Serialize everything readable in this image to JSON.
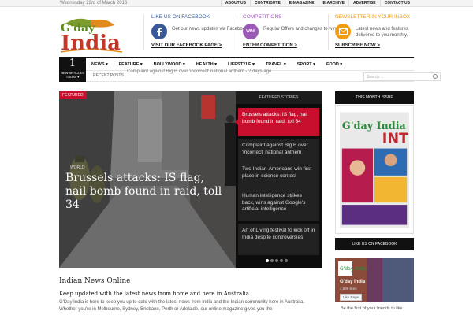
{
  "topbar": {
    "date": "Wednesday 23rd of March 2016",
    "links": [
      "ABOUT US",
      "CONTRIBUTE",
      "E-MAGAZINE",
      "E-ARCHIVE",
      "ADVERTISE",
      "CONTACT US"
    ]
  },
  "header": {
    "logo_text": "G'day India",
    "facebook": {
      "title": "LIKE US ON FACEBOOK",
      "desc": "Get our news updates via Facebook",
      "link": "VISIT OUR FACEBOOK PAGE >",
      "color": "#3b5998"
    },
    "competitions": {
      "title": "COMPETITIONS",
      "desc": "Regular Offers and changes to win",
      "link": "ENTER COMPETITION >",
      "color": "#9b59b6",
      "icon_text": "WIN!"
    },
    "newsletter": {
      "title": "NEWSLETTER IN YOUR INBOX",
      "desc": "Latest news and features delivered to you monthly.",
      "link": "SUBSCRIBE NOW >",
      "color": "#f39c12"
    }
  },
  "nav": {
    "badge_num": "1",
    "badge_cap": "NEW ARTICLES TODAY ▾",
    "items": [
      "NEWS ▾",
      "FEATURE ▾",
      "BOLLYWOOD ▾",
      "HEALTH ▾",
      "LIFESTYLE ▾",
      "TRAVEL ▾",
      "SPORT ▾",
      "FOOD ▾"
    ],
    "recent_label": "RECENT POSTS",
    "ticker": "Complaint against Big B over 'incorrect' national anthem - 2 days ago",
    "search_placeholder": "Search ..."
  },
  "slider": {
    "tag": "FEATURED",
    "kicker": "WORLD",
    "title": "Brussels attacks: IS flag, nail bomb found in raid, toll 34",
    "panel_title": "FEATURED STORIES",
    "stories": [
      "Brussels attacks: IS flag, nail bomb found in raid, toll 34",
      "Complaint against Big B over 'incorrect' national anthem",
      "Two Indian-Americans win first place in science contest",
      "Human intelligence strikes back, wins against Google's artificial intelligence",
      "Art of Living festival to kick off in India despite controversies"
    ]
  },
  "content": {
    "title": "Indian News Online",
    "subtitle": "Keep updated with the latest news from home and here in Australia",
    "text": "G'Day India is here to keep you up to date with the latest news from India and the Indian community here in Australia. Whether you're in Melbourne, Sydney, Brisbane, Perth or Adelaide, our online magazine gives you the"
  },
  "sidebar": {
    "issue_title": "THIS MONTH ISSUE",
    "mag_logo": "G'day India",
    "mag_tag": "INT",
    "fb_title": "LIKE US ON FACEBOOK",
    "fb_name": "G'day India",
    "fb_likes": "4,699 likes",
    "fb_button": "Like Page",
    "fb_note": "Be the first of your friends to like"
  },
  "colors": {
    "accent": "#c8102e",
    "dark": "#111111",
    "facebook": "#3b5998"
  }
}
